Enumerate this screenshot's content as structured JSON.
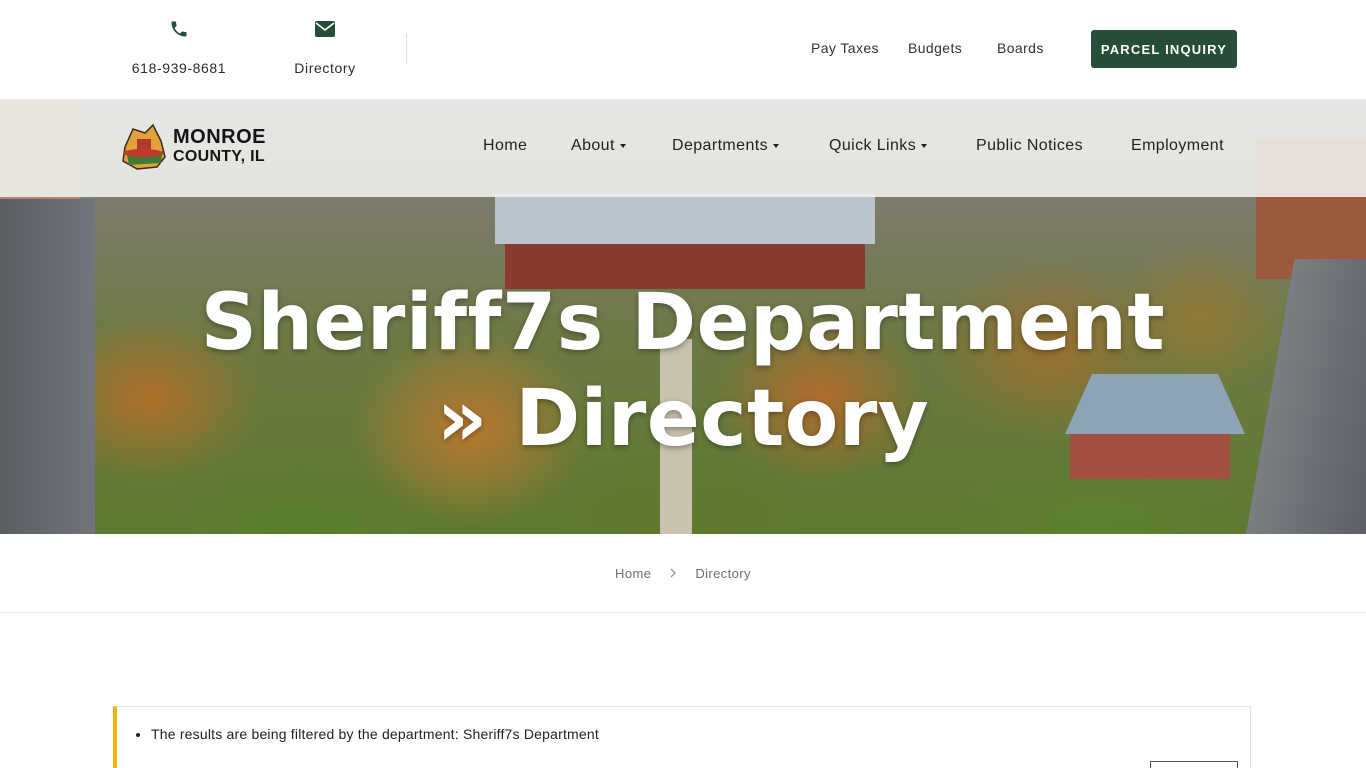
{
  "topbar": {
    "phone": {
      "icon": "phone-icon",
      "text": "618-939-8681"
    },
    "directory": {
      "icon": "envelope-icon",
      "text": "Directory"
    },
    "links": {
      "pay_taxes": "Pay Taxes",
      "budgets": "Budgets",
      "boards": "Boards"
    },
    "parcel_button": "PARCEL INQUIRY",
    "icon_color": "#264d35"
  },
  "logo": {
    "line1": "MONROE",
    "line2": "COUNTY, IL"
  },
  "nav": {
    "home": "Home",
    "about": "About",
    "departments": "Departments",
    "quick_links": "Quick Links",
    "public_notices": "Public Notices",
    "employment": "Employment"
  },
  "hero": {
    "title": "Sheriff7s Department » Directory"
  },
  "breadcrumb": {
    "home": "Home",
    "current": "Directory"
  },
  "notice": {
    "message": "The results are being filtered by the department: Sheriff7s Department"
  },
  "colors": {
    "brand_green": "#264d35",
    "notice_accent": "#f0b400"
  }
}
